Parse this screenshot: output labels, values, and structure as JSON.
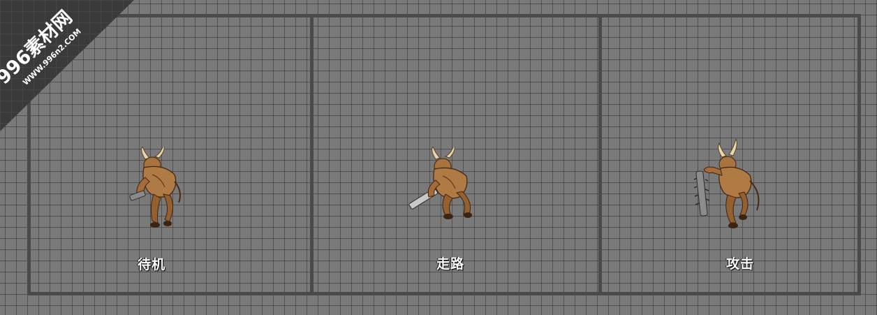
{
  "watermark": {
    "site": "996素材网",
    "url": "WWW.996n2.COM"
  },
  "panels": [
    {
      "label": "待机",
      "sprite": "minotaur-idle-sprite"
    },
    {
      "label": "走路",
      "sprite": "minotaur-walk-sprite"
    },
    {
      "label": "攻击",
      "sprite": "minotaur-attack-sprite"
    }
  ],
  "colors": {
    "background": "#7b7a7b",
    "grid": "#4a4a4a",
    "frame": "#4a4a4a",
    "label": "#ffffff",
    "watermark_band": "#3a3a3a",
    "creature_skin": "#b07a45"
  }
}
